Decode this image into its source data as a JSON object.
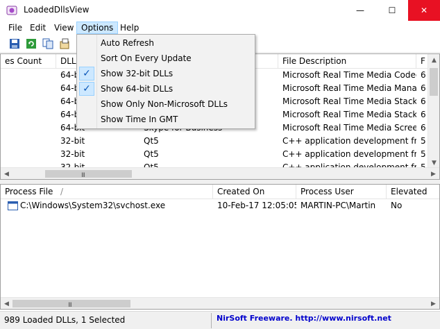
{
  "window": {
    "title": "LoadedDllsView",
    "icon": "purple-dll-icon",
    "minimize": "—",
    "maximize": "☐",
    "close": "✕"
  },
  "menu": {
    "items": [
      "File",
      "Edit",
      "View",
      "Options",
      "Help"
    ],
    "active": "Options"
  },
  "toolbar": {
    "buttons": [
      "save-icon",
      "refresh-icon",
      "copy-icon",
      "properties-icon"
    ]
  },
  "options_menu": {
    "items": [
      {
        "label": "Auto Refresh",
        "checked": false
      },
      {
        "label": "Sort On Every Update",
        "checked": false
      },
      {
        "label": "Show 32-bit DLLs",
        "checked": true
      },
      {
        "label": "Show 64-bit DLLs",
        "checked": true
      },
      {
        "label": "Show Only Non-Microsoft DLLs",
        "checked": false
      },
      {
        "label": "Show Time In GMT",
        "checked": false
      }
    ],
    "check_glyph": "✓"
  },
  "dll_list": {
    "columns": [
      "es Count",
      "DLL",
      "",
      "File Description",
      "F"
    ],
    "rows": [
      {
        "count": "",
        "dll": "64-bi",
        "product": "",
        "description": "Microsoft Real Time Media Codec...",
        "f": "6"
      },
      {
        "count": "",
        "dll": "64-bi",
        "product": "",
        "description": "Microsoft Real Time Media Mana...",
        "f": "6"
      },
      {
        "count": "",
        "dll": "64-bi",
        "product": "",
        "description": "Microsoft Real Time Media Stack ...",
        "f": "6"
      },
      {
        "count": "",
        "dll": "64-bi",
        "product": "",
        "description": "Microsoft Real Time Media Stack",
        "f": "6"
      },
      {
        "count": "",
        "dll": "64-bit",
        "product": "Skype for Business",
        "description": "Microsoft Real Time Media Scree...",
        "f": "6"
      },
      {
        "count": "",
        "dll": "32-bit",
        "product": "Qt5",
        "description": "C++ application development fra...",
        "f": "5"
      },
      {
        "count": "",
        "dll": "32-bit",
        "product": "Qt5",
        "description": "C++ application development fra...",
        "f": "5"
      },
      {
        "count": "",
        "dll": "32-bit",
        "product": "Qt5",
        "description": "C++ application development fra...",
        "f": "5"
      }
    ]
  },
  "process_list": {
    "columns": [
      "Process File",
      "Created On",
      "Process User",
      "Elevated"
    ],
    "sort_glyph": "/",
    "rows": [
      {
        "file": "C:\\Windows\\System32\\svchost.exe",
        "created": "10-Feb-17 12:05:05",
        "user": "MARTIN-PC\\Martin",
        "elevated": "No"
      }
    ]
  },
  "scrollbar": {
    "up": "▲",
    "down": "▼",
    "left": "◀",
    "right": "▶",
    "grip": "III"
  },
  "status": {
    "left": "989 Loaded DLLs, 1 Selected",
    "right": "NirSoft Freeware.  http://www.nirsoft.net"
  }
}
